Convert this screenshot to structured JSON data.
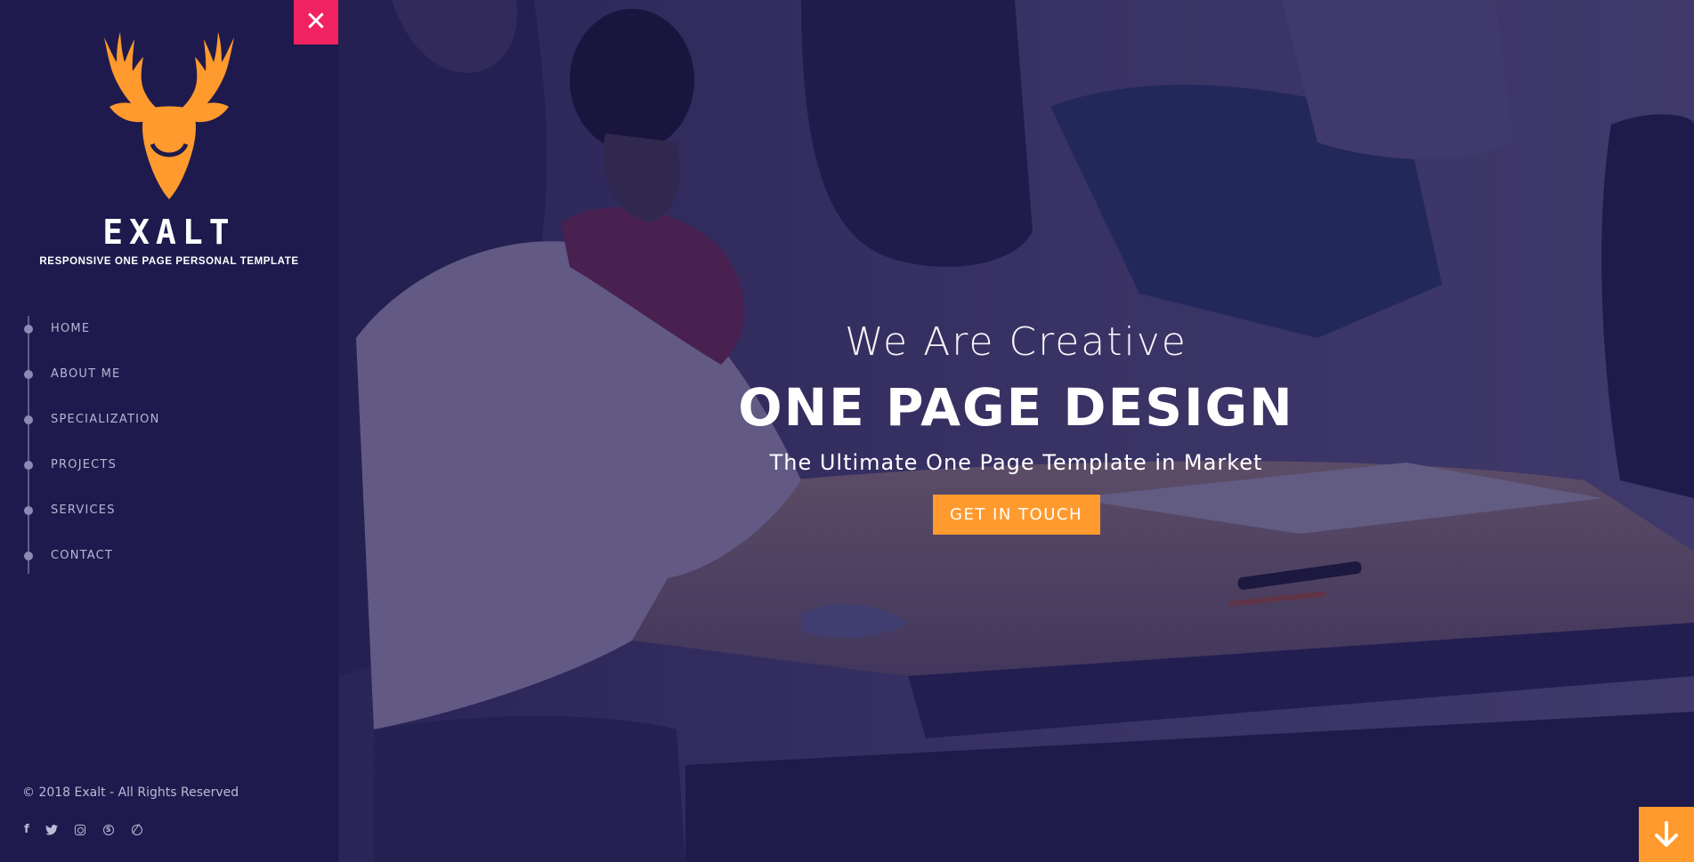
{
  "brand": {
    "name": "EXALT",
    "tagline": "RESPONSIVE ONE PAGE PERSONAL TEMPLATE",
    "logo_icon": "deer-head-icon",
    "logo_color": "#ff9a2e"
  },
  "nav": {
    "items": [
      {
        "label": "HOME"
      },
      {
        "label": "ABOUT ME"
      },
      {
        "label": "SPECIALIZATION"
      },
      {
        "label": "PROJECTS"
      },
      {
        "label": "SERVICES"
      },
      {
        "label": "CONTACT"
      }
    ]
  },
  "footer": {
    "copyright": "© 2018 Exalt - All Rights Reserved",
    "socials": [
      {
        "icon": "facebook-icon",
        "glyph": "f"
      },
      {
        "icon": "twitter-icon",
        "glyph": "🐦"
      },
      {
        "icon": "instagram-icon",
        "glyph": ""
      },
      {
        "icon": "skype-icon",
        "glyph": "S"
      },
      {
        "icon": "dribbble-icon",
        "glyph": ""
      }
    ]
  },
  "close_button": {
    "glyph": "✕",
    "icon": "close-icon",
    "color": "#f0225f"
  },
  "hero": {
    "kicker": "We Are Creative",
    "title": "ONE PAGE DESIGN",
    "subtitle": "The Ultimate One Page Template in Market",
    "cta_label": "GET IN TOUCH",
    "cta_color": "#ff9a2e",
    "overlay_color": "#1e1a4d"
  },
  "scroll_button": {
    "icon": "arrow-down-icon",
    "color": "#ff9a2e"
  }
}
